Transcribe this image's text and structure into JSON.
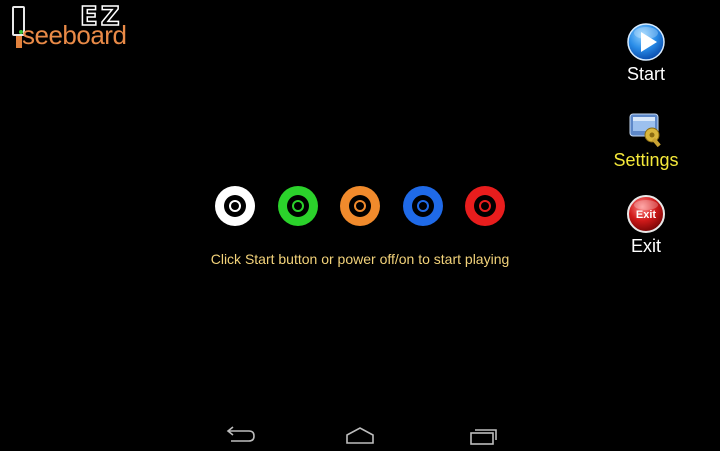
{
  "logo": {
    "title_top": "EZ",
    "title_bottom": "seeboard"
  },
  "menu": {
    "start_label": "Start",
    "settings_label": "Settings",
    "exit_label": "Exit",
    "exit_icon_text": "Exit",
    "start_icon": "play-icon",
    "settings_icon": "settings-icon",
    "exit_icon": "exit-icon",
    "start_label_color": "#ffffff",
    "settings_label_color": "#f5e93a",
    "exit_label_color": "#ffffff"
  },
  "jacks": [
    {
      "name": "white-jack",
      "color": "#ffffff"
    },
    {
      "name": "green-jack",
      "color": "#2bd22b"
    },
    {
      "name": "orange-jack",
      "color": "#f08a2c"
    },
    {
      "name": "blue-jack",
      "color": "#1f6ae8"
    },
    {
      "name": "red-jack",
      "color": "#e81d1d"
    }
  ],
  "hint": {
    "text": "Click Start button or power off/on to start playing",
    "color": "#f2d27a"
  },
  "navbar": {
    "back_icon": "back-icon",
    "home_icon": "home-icon",
    "recents_icon": "recents-icon"
  }
}
